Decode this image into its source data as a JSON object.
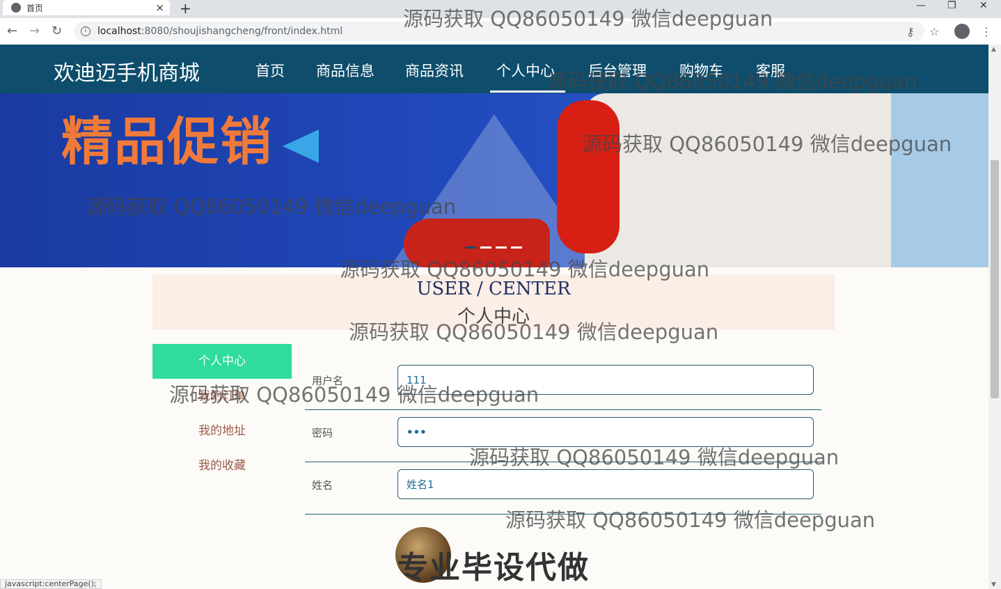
{
  "browser": {
    "tab_title": "首页",
    "tab_close": "×",
    "new_tab": "+",
    "url_host": "localhost",
    "url_path": ":8080/shoujishangcheng/front/index.html",
    "back": "←",
    "forward": "→",
    "reload": "↻",
    "key": "⚷",
    "star": "☆",
    "menu": "⋮",
    "minimize": "—",
    "restore": "❐",
    "close": "✕"
  },
  "nav": {
    "brand": "欢迪迈手机商城",
    "items": [
      "首页",
      "商品信息",
      "商品资讯",
      "个人中心",
      "后台管理",
      "购物车",
      "客服"
    ],
    "active_index": 3,
    "bg_color": "#0e4d6c"
  },
  "banner": {
    "promo_title": "精品促销",
    "slide_count": 4,
    "active_slide": 0
  },
  "center": {
    "title_en": "USER / CENTER",
    "title_zh": "个人中心"
  },
  "side_menu": {
    "items": [
      "个人中心",
      "我的订单",
      "我的地址",
      "我的收藏"
    ],
    "active_index": 0,
    "active_color": "#2fdc9c"
  },
  "form": {
    "username_label": "用户名",
    "username_value": "111",
    "password_label": "密码",
    "password_value": "•••",
    "name_label": "姓名",
    "name_value": "姓名1",
    "photo_text": "专业毕设代做"
  },
  "status_bar": "javascript:centerPage();",
  "watermark": "源码获取 QQ86050149 微信deepguan"
}
